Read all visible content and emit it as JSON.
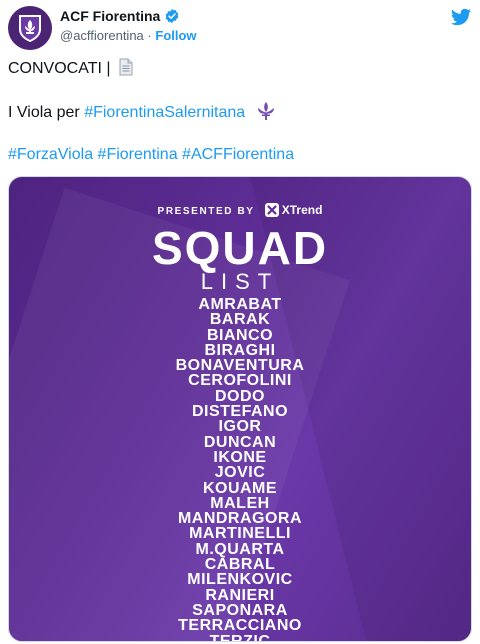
{
  "account": {
    "display_name": "ACF Fiorentina",
    "handle": "@acffiorentina",
    "separator": "·",
    "follow_label": "Follow"
  },
  "tweet": {
    "line1_text": "CONVOCATI |",
    "line2_text": "I Viola per ",
    "line2_hashtag": "#FiorentinaSalernitana",
    "hashtags": [
      "#ForzaViola",
      "#Fiorentina",
      "#ACFFiorentina"
    ]
  },
  "graphic": {
    "presented_by": "PRESENTED BY",
    "sponsor": "XTrend",
    "title": "SQUAD",
    "subtitle": "LIST",
    "players": [
      "AMRABAT",
      "BARAK",
      "BIANCO",
      "BIRAGHI",
      "BONAVENTURA",
      "CEROFOLINI",
      "DODO",
      "DISTEFANO",
      "IGOR",
      "DUNCAN",
      "IKONE",
      "JOVIC",
      "KOUAME",
      "MALEH",
      "MANDRAGORA",
      "MARTINELLI",
      "M.QUARTA",
      "CABRAL",
      "MILENKOVIC",
      "RANIERI",
      "SAPONARA",
      "TERRACCIANO",
      "TERZIC"
    ]
  },
  "colors": {
    "accent": "#1d9bf0",
    "viola": "#5d2d95"
  },
  "icons": [
    "fiorentina-logo-icon",
    "verified-badge-icon",
    "twitter-bird-icon",
    "document-icon",
    "fleur-de-lis-icon",
    "xtrend-logo-icon"
  ]
}
